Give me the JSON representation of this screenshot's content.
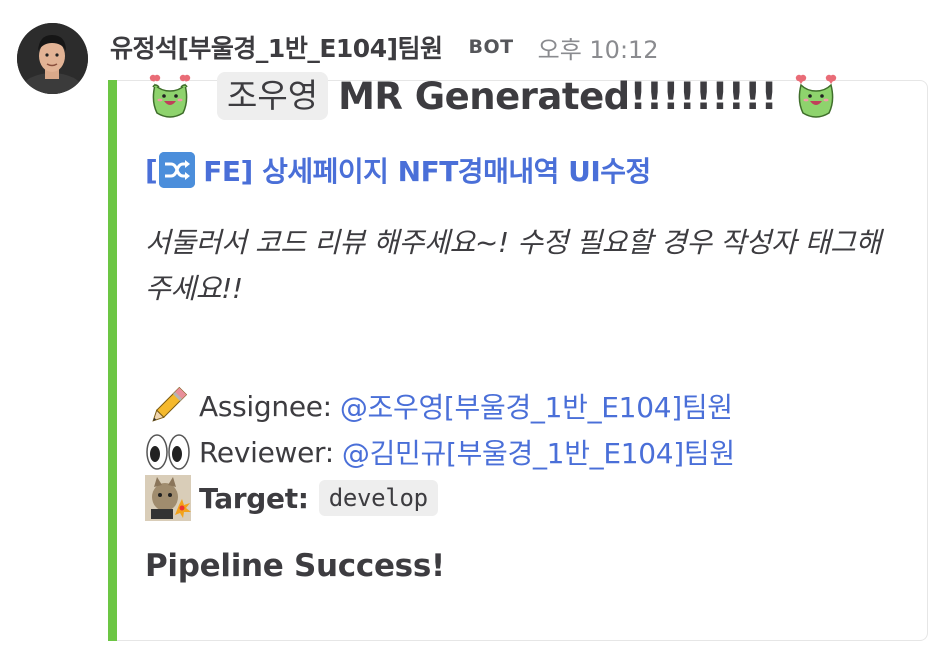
{
  "message": {
    "sender": "유정석[부울경_1반_E104]팀원",
    "badge": "BOT",
    "time": "오후 10:12"
  },
  "attachment": {
    "accent_color": "#6cc644",
    "title": {
      "name_chip": "조우영",
      "text": "MR Generated!!!!!!!!!",
      "left_emoji": "frog-heart-icon",
      "right_emoji": "frog-heart-icon"
    },
    "mr_link": {
      "prefix": "[",
      "icon": "shuffle-icon",
      "text": "FE] 상세페이지 NFT경매내역 UI수정"
    },
    "description": "서둘러서 코드 리뷰 해주세요~! 수정 필요할 경우 작성자 태그해주세요!!",
    "assignee": {
      "icon": "pencil-icon",
      "label": "Assignee:",
      "mention": "@조우영[부울경_1반_E104]팀원"
    },
    "reviewer": {
      "icon": "eyes-icon",
      "label": "Reviewer:",
      "mention": "@김민규[부울경_1반_E104]팀원"
    },
    "target": {
      "icon": "cat-bomb-icon",
      "label": "Target:",
      "branch": "develop"
    },
    "footer": "Pipeline Success!"
  }
}
